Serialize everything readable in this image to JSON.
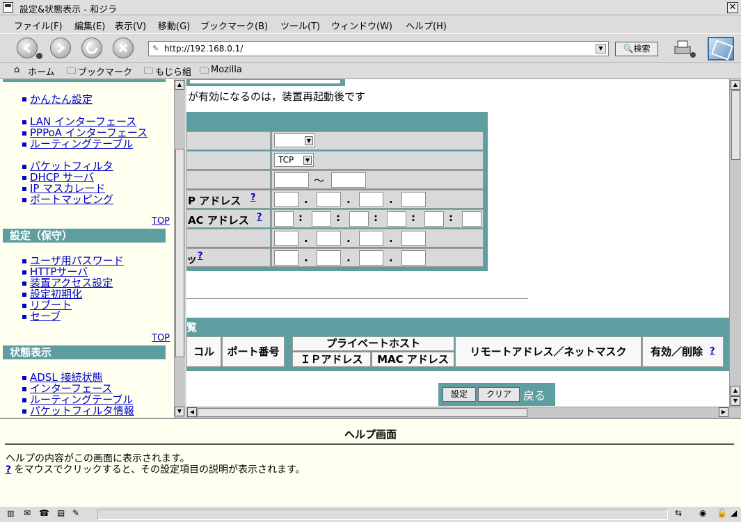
{
  "window": {
    "title": "設定&状態表示 - 和ジラ"
  },
  "menu": {
    "file": "ファイル(F)",
    "edit": "編集(E)",
    "view": "表示(V)",
    "go": "移動(G)",
    "bookmarks": "ブックマーク(B)",
    "tools": "ツール(T)",
    "window": "ウィンドウ(W)",
    "help": "ヘルプ(H)"
  },
  "nav": {
    "url": "http://192.168.0.1/",
    "search_label": "検索"
  },
  "bookmarks_bar": {
    "home": "ホーム",
    "bookmarks": "ブックマーク",
    "mojira": "もじら組",
    "mozilla": "Mozilla"
  },
  "sidebar": {
    "easy_setup": "かんたん設定",
    "group1": [
      "LAN インターフェース",
      "PPPoA インターフェース",
      "ルーティングテーブル"
    ],
    "group2": [
      "パケットフィルタ",
      "DHCP サーバ",
      "IP マスカレード",
      "ポートマッピング"
    ],
    "top1": "TOP",
    "maintenance_title": "設定（保守）",
    "group3": [
      "ユーザ用パスワード",
      "HTTPサーバ",
      "装置アクセス設定",
      "設定初期化",
      "リブート",
      "セーブ"
    ],
    "top2": "TOP",
    "status_title": "状態表示",
    "group4": [
      "ADSL 接続状態",
      "インターフェース",
      "ルーティングテーブル",
      "パケットフィルタ情報"
    ]
  },
  "main": {
    "notice": "が有効になるのは，装置再起動後です",
    "protocol_value": "TCP",
    "range_sep": "〜",
    "ip_label": "P アドレス",
    "mac_label": "AC アドレス",
    "mask_label": "ッ",
    "help_q": "?",
    "list_title_fragment": "覧",
    "col_protocol": "コル",
    "col_port": "ポート番号",
    "col_private_host": "プライベートホスト",
    "col_ip": "ＩＰアドレス",
    "col_mac": "MAC アドレス",
    "col_remote": "リモートアドレス／ネットマスク",
    "col_valid": "有効／削除",
    "btn_set": "設定",
    "btn_clear": "クリア",
    "btn_back": "戻る"
  },
  "help": {
    "title": "ヘルプ画面",
    "line1": "ヘルプの内容がこの画面に表示されます。",
    "line2_q": "?",
    "line2": " をマウスでクリックすると、その設定項目の説明が表示されます。"
  },
  "colors": {
    "accent": "#5f9ea0",
    "link": "#0000cc",
    "sidebar_bg": "#fffff0"
  }
}
